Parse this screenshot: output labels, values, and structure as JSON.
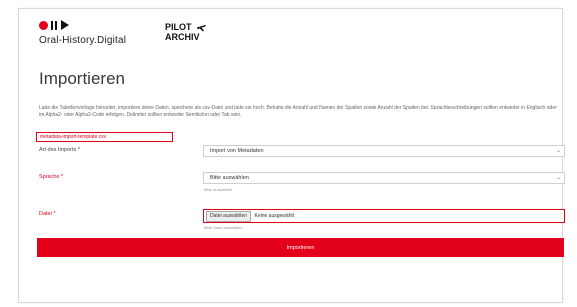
{
  "header": {
    "logo_text": "Oral-History.Digital",
    "pilot_line1": "PILOT",
    "pilot_line2": "ARCHIV"
  },
  "page": {
    "title": "Importieren",
    "intro": "Lade die Tabellenvorlage hierunter, importiere deine Daten, speichere als csv-Datei und lade sie hoch. Behalte die Anzahl und Namen der Spalten sowie Anzahl der Spalten bei. Sprachbeschreibungen sollten entweder in Englisch oder im Alpha2- oder Alpha3-Code erfolgen. Delimiter sollten entweder Semikolon oder Tab sein.",
    "template_link": "metadata-import-template.csv"
  },
  "form": {
    "type_label": "Art des Imports *",
    "type_value": "Import von Metadaten",
    "language_label": "Sprache *",
    "language_value": "Bitte auswählen",
    "language_hint": "Bitte auswählen",
    "file_label": "Datei *",
    "file_button": "Datei auswählen",
    "file_status": "Keine ausgewählt",
    "file_hint": "Bitte Datei auswählen",
    "submit_label": "Importieren"
  },
  "colors": {
    "accent": "#e3001b"
  }
}
